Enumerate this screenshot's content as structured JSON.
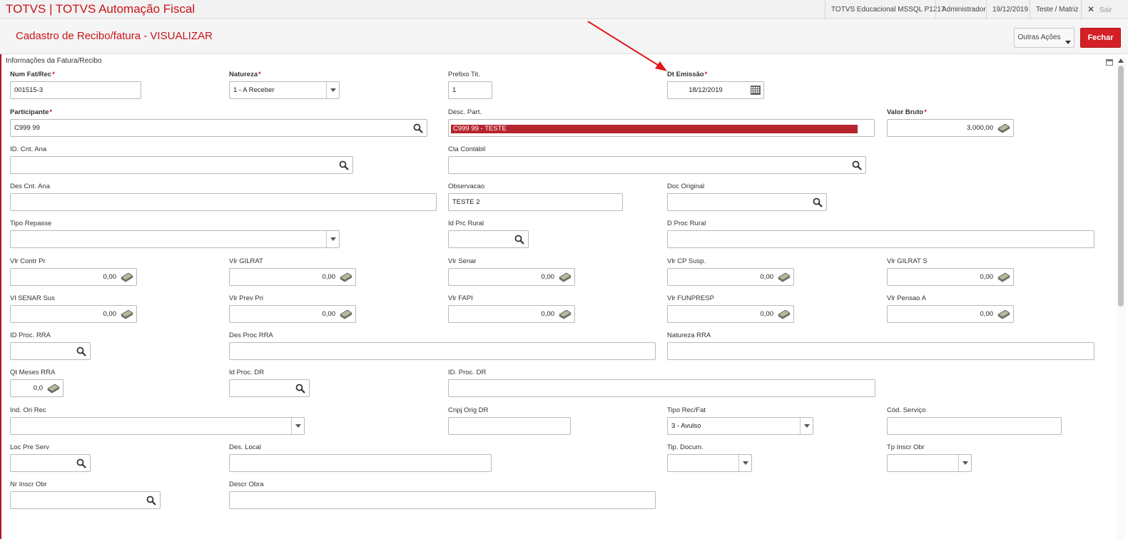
{
  "topbar": {
    "app_title": "TOTVS | TOTVS Automação Fiscal",
    "environment": "TOTVS Educacional MSSQL P1217",
    "user": "Administrador",
    "date": "19/12/2019",
    "branch": "Teste / Matriz",
    "exit_label": "Sair"
  },
  "header": {
    "page_title": "Cadastro de Recibo/fatura - VISUALIZAR",
    "outras_acoes": "Outras Ações",
    "fechar": "Fechar"
  },
  "section_title": "Informações da Fatura/Recibo",
  "fields": {
    "num_fat": {
      "label": "Num Fat/Rec",
      "value": "001515-3"
    },
    "natureza": {
      "label": "Natureza",
      "value": "1 - A Receber"
    },
    "prefixo": {
      "label": "Prefixo Tit.",
      "value": "1"
    },
    "dt_emissao": {
      "label": "Dt Emissão",
      "value": "18/12/2019"
    },
    "participante": {
      "label": "Participante",
      "value": "C999   99"
    },
    "desc_part": {
      "label": "Desc. Part.",
      "value": "C999   99 - TESTE"
    },
    "valor_bruto": {
      "label": "Valor Bruto",
      "value": "3.000,00"
    },
    "id_cnt_ana": {
      "label": "ID. Cnt. Ana",
      "value": ""
    },
    "cta_contabil": {
      "label": "Cta Contábil",
      "value": ""
    },
    "des_cnt_ana": {
      "label": "Des Cnt. Ana",
      "value": ""
    },
    "observacao": {
      "label": "Observacao",
      "value": "TESTE 2"
    },
    "doc_original": {
      "label": "Doc Original",
      "value": ""
    },
    "tipo_repasse": {
      "label": "Tipo Repasse",
      "value": ""
    },
    "id_prc_rural": {
      "label": "Id Prc Rural",
      "value": ""
    },
    "d_proc_rural": {
      "label": "D Proc Rural",
      "value": ""
    },
    "vlr_contr_pr": {
      "label": "Vlr Contr Pr",
      "value": "0,00"
    },
    "vlr_gilrat": {
      "label": "Vlr GILRAT",
      "value": "0,00"
    },
    "vlr_senar": {
      "label": "Vlr Senar",
      "value": "0,00"
    },
    "vlr_cp_susp": {
      "label": "Vlr CP Susp.",
      "value": "0,00"
    },
    "vlr_gilrat_s": {
      "label": "Vlr GILRAT S",
      "value": "0,00"
    },
    "vl_senar_sus": {
      "label": "Vl SENAR Sus",
      "value": "0,00"
    },
    "vlr_prev_pri": {
      "label": "Vlr Prev Pri",
      "value": "0,00"
    },
    "vlr_fapi": {
      "label": "Vlr FAPI",
      "value": "0,00"
    },
    "vlr_funpresp": {
      "label": "Vlr FUNPRESP",
      "value": "0,00"
    },
    "vlr_pensao_a": {
      "label": "Vlr Pensao A",
      "value": "0,00"
    },
    "id_proc_rra": {
      "label": "ID Proc. RRA",
      "value": ""
    },
    "des_proc_rra": {
      "label": "Des Proc RRA",
      "value": ""
    },
    "natureza_rra": {
      "label": "Natureza RRA",
      "value": ""
    },
    "qt_meses_rra": {
      "label": "Qt Meses RRA",
      "value": "0,0"
    },
    "id_proc_dr": {
      "label": "Id Proc. DR",
      "value": ""
    },
    "id_proc_dr2": {
      "label": "ID. Proc. DR",
      "value": ""
    },
    "ind_ori_rec": {
      "label": "Ind. Ori Rec",
      "value": ""
    },
    "cnpj_orig_dr": {
      "label": "Cnpj Orig DR",
      "value": ""
    },
    "tipo_rec_fat": {
      "label": "Tipo Rec/Fat",
      "value": "3 - Avulso"
    },
    "cod_servico": {
      "label": "Cód. Serviço",
      "value": ""
    },
    "loc_pre_serv": {
      "label": "Loc Pre Serv",
      "value": ""
    },
    "des_local": {
      "label": "Des. Local",
      "value": ""
    },
    "tip_docum": {
      "label": "Tip. Docum.",
      "value": ""
    },
    "tp_inscr_obr": {
      "label": "Tp Inscr Obr",
      "value": ""
    },
    "nr_inscr_obr": {
      "label": "Nr Inscr Obr",
      "value": ""
    },
    "descr_obra": {
      "label": "Descr Obra",
      "value": ""
    }
  },
  "colors": {
    "brand_red": "#c7141a",
    "button_red": "#d41f26",
    "annotation_arrow": "#e0191f"
  }
}
